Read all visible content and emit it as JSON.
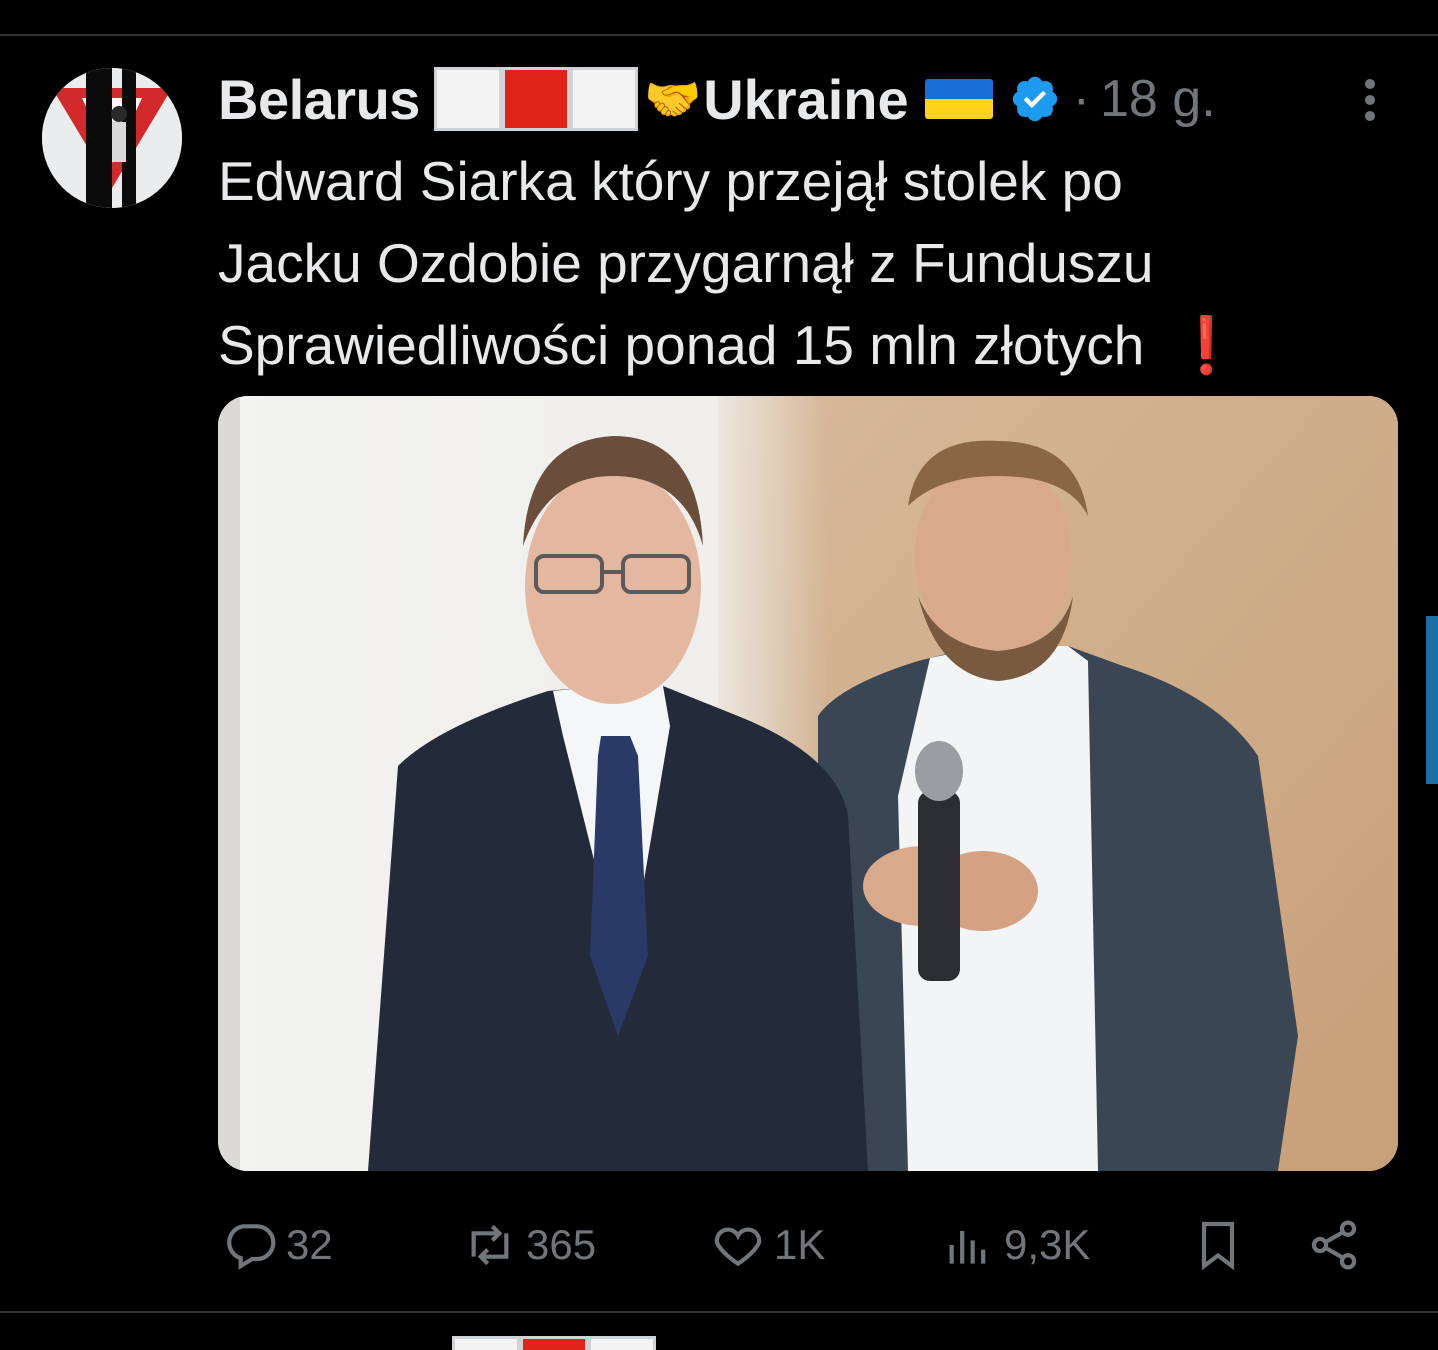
{
  "tweet": {
    "display_name_part1": "Belarus",
    "handshake_emoji": "🤝",
    "display_name_part2": "Ukraine",
    "separator": "·",
    "timestamp": "18 g.",
    "text_lines": [
      "Edward Siarka który przejął stolek po",
      "Jacku Ozdobie przygarnął z Funduszu",
      "Sprawiedliwości ponad 15 mln złotych"
    ],
    "exclamation_emoji": "❗"
  },
  "actions": {
    "replies": "32",
    "reposts": "365",
    "likes": "1K",
    "views": "9,3K"
  },
  "colors": {
    "background": "#000000",
    "text": "#e7e9ea",
    "muted": "#71767b",
    "verified": "#1d9bf0",
    "divider": "#2f3336"
  },
  "icons": [
    "avatar",
    "belarus-flag-icon",
    "handshake-icon",
    "ukraine-flag-icon",
    "verified-badge-icon",
    "more-icon",
    "reply-icon",
    "repost-icon",
    "like-icon",
    "views-icon",
    "bookmark-icon",
    "share-icon"
  ]
}
